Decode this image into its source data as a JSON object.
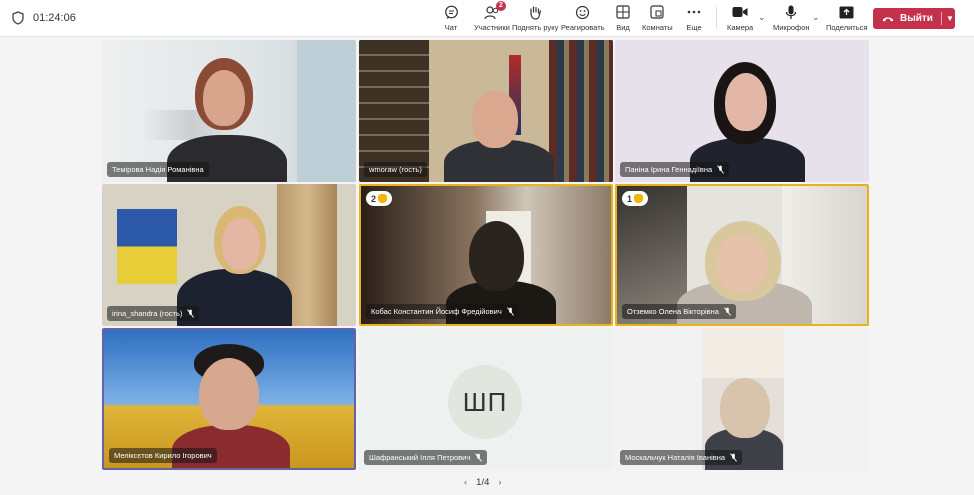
{
  "meeting": {
    "timer": "01:24:06"
  },
  "toolbar": {
    "chat": "Чат",
    "participants": "Участники",
    "participants_badge": "2",
    "raise_hand": "Поднять руку",
    "react": "Реагировать",
    "view": "Вид",
    "rooms": "Комнаты",
    "more": "Еще",
    "camera": "Камера",
    "mic": "Микрофон",
    "share": "Поделиться",
    "leave": "Выйти"
  },
  "tiles": [
    {
      "name": "Темірова Надія Романівна",
      "muted": false
    },
    {
      "name": "wmoraw (гость)",
      "muted": false
    },
    {
      "name": "Паніна Ірина Геннадіївна",
      "muted": true
    },
    {
      "name": "irina_shandra (гость)",
      "muted": true
    },
    {
      "name": "Кобас Константин Йосиф Фредійович",
      "muted": true,
      "hand": "2"
    },
    {
      "name": "Отземко Олена Вікторівна",
      "muted": true,
      "hand": "1"
    },
    {
      "name": "Меліксєтов Кирило Ігорович",
      "muted": false
    },
    {
      "name": "Шафранський Ілля Петрович",
      "muted": true,
      "initials": "ШП"
    },
    {
      "name": "Москальчук Наталія Іванівна",
      "muted": true
    }
  ],
  "pager": {
    "label": "1/4"
  },
  "colors": {
    "accent": "#6264a7",
    "leave": "#c4314b",
    "hand_highlight": "#e8b21c"
  }
}
